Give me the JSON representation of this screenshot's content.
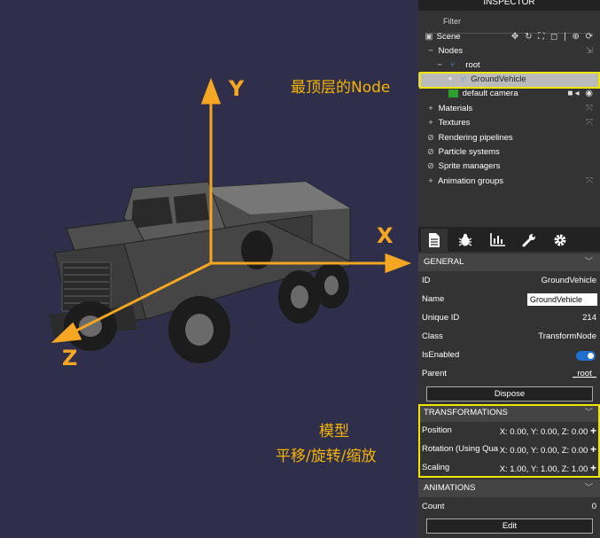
{
  "viewport": {
    "axes": {
      "x": "X",
      "y": "Y",
      "z": "Z"
    },
    "notes": {
      "top_node": "最顶层的Node",
      "model_line1": "模型",
      "model_line2": "平移/旋转/缩放"
    },
    "colors": {
      "axis": "#f5a623",
      "background": "#2f2f4c",
      "highlight": "#f2e600"
    }
  },
  "inspector": {
    "title": "INSPECTOR",
    "filter_placeholder": "Filter",
    "tree": {
      "scene": "Scene",
      "nodes": "Nodes",
      "root": "root",
      "ground_vehicle": "GroundVehicle",
      "default_camera": "default camera",
      "materials": "Materials",
      "textures": "Textures",
      "rendering_pipelines": "Rendering pipelines",
      "particle_systems": "Particle systems",
      "sprite_managers": "Sprite managers",
      "animation_groups": "Animation groups"
    },
    "tabs": [
      "properties-icon",
      "debug-icon",
      "statistics-icon",
      "tools-icon",
      "settings-icon"
    ],
    "general": {
      "header": "GENERAL",
      "id_label": "ID",
      "id_value": "GroundVehicle",
      "name_label": "Name",
      "name_value": "GroundVehicle",
      "unique_id_label": "Unique ID",
      "unique_id_value": "214",
      "class_label": "Class",
      "class_value": "TransformNode",
      "isenabled_label": "IsEnabled",
      "isenabled_value": true,
      "parent_label": "Parent",
      "parent_value": "_root_",
      "dispose_label": "Dispose"
    },
    "transformations": {
      "header": "TRANSFORMATIONS",
      "position_label": "Position",
      "position_value": "X: 0.00, Y: 0.00, Z: 0.00",
      "rotation_label": "Rotation (Using Qua",
      "rotation_value": "X: 0.00, Y: 0.00, Z: 0.00",
      "scaling_label": "Scaling",
      "scaling_value": "X: 1.00, Y: 1.00, Z: 1.00"
    },
    "animations": {
      "header": "ANIMATIONS",
      "count_label": "Count",
      "count_value": "0",
      "edit_label": "Edit"
    }
  }
}
